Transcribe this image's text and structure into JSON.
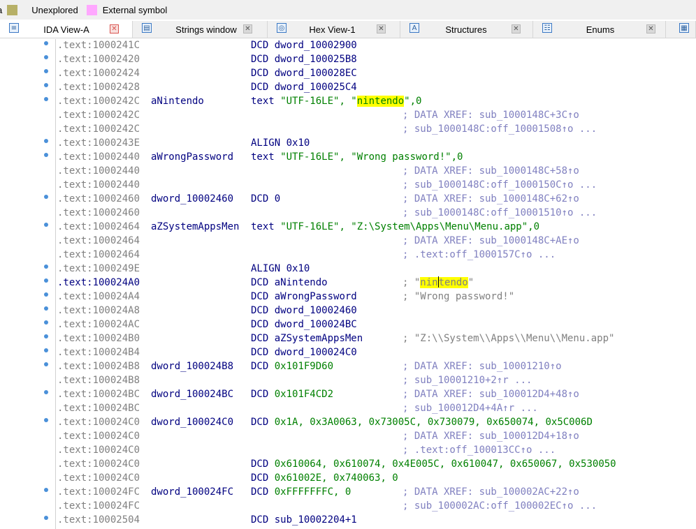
{
  "legend": [
    {
      "label": "a",
      "color": "#c0c0a0"
    },
    {
      "label": "Unexplored",
      "color": "#b7b067"
    },
    {
      "label": "External symbol",
      "color": "#ffa8ff"
    }
  ],
  "tabs": [
    {
      "label": "IDA View-A",
      "icon": "ida-view-icon",
      "active": true
    },
    {
      "label": "Strings window",
      "icon": "strings-icon",
      "active": false
    },
    {
      "label": "Hex View-1",
      "icon": "hex-icon",
      "active": false
    },
    {
      "label": "Structures",
      "icon": "structures-icon",
      "active": false
    },
    {
      "label": "Enums",
      "icon": "enums-icon",
      "active": false
    }
  ],
  "lines": [
    {
      "addr": ".text:1000241C",
      "label": "",
      "op": "DCD",
      "args": "dword_10002900",
      "comment": "",
      "dot": true
    },
    {
      "addr": ".text:10002420",
      "label": "",
      "op": "DCD",
      "args": "dword_100025B8",
      "comment": "",
      "dot": true
    },
    {
      "addr": ".text:10002424",
      "label": "",
      "op": "DCD",
      "args": "dword_100028EC",
      "comment": "",
      "dot": true
    },
    {
      "addr": ".text:10002428",
      "label": "",
      "op": "DCD",
      "args": "dword_100025C4",
      "comment": "",
      "dot": true
    },
    {
      "addr": ".text:1000242C",
      "label": "aNintendo",
      "op": "text",
      "pre": "\"UTF-16LE\", \"",
      "hl": "nintendo",
      "post": "\",0",
      "comment": "",
      "dot": true
    },
    {
      "addr": ".text:1000242C",
      "label": "",
      "op": "",
      "args": "",
      "comment": "; DATA XREF: sub_1000148C+3C↑o",
      "dot": false
    },
    {
      "addr": ".text:1000242C",
      "label": "",
      "op": "",
      "args": "",
      "comment": "; sub_1000148C:off_10001508↑o ...",
      "dot": false
    },
    {
      "addr": ".text:1000243E",
      "label": "",
      "op": "ALIGN",
      "args": "0x10",
      "comment": "",
      "dot": true
    },
    {
      "addr": ".text:10002440",
      "label": "aWrongPassword",
      "op": "text",
      "pre": "\"UTF-16LE\", \"Wrong password!\",0",
      "hl": "",
      "post": "",
      "comment": "",
      "dot": true
    },
    {
      "addr": ".text:10002440",
      "label": "",
      "op": "",
      "args": "",
      "comment": "; DATA XREF: sub_1000148C+58↑o",
      "dot": false
    },
    {
      "addr": ".text:10002440",
      "label": "",
      "op": "",
      "args": "",
      "comment": "; sub_1000148C:off_1000150C↑o ...",
      "dot": false
    },
    {
      "addr": ".text:10002460",
      "label": "dword_10002460",
      "op": "DCD",
      "args": "0",
      "comment": "; DATA XREF: sub_1000148C+62↑o",
      "dot": true
    },
    {
      "addr": ".text:10002460",
      "label": "",
      "op": "",
      "args": "",
      "comment": "; sub_1000148C:off_10001510↑o ...",
      "dot": false
    },
    {
      "addr": ".text:10002464",
      "label": "aZSystemAppsMen",
      "op": "text",
      "pre": "\"UTF-16LE\", \"Z:\\System\\Apps\\Menu\\Menu.app\",0",
      "hl": "",
      "post": "",
      "comment": "",
      "dot": true
    },
    {
      "addr": ".text:10002464",
      "label": "",
      "op": "",
      "args": "",
      "comment": "; DATA XREF: sub_1000148C+AE↑o",
      "dot": false
    },
    {
      "addr": ".text:10002464",
      "label": "",
      "op": "",
      "args": "",
      "comment": "; .text:off_1000157C↑o ...",
      "dot": false
    },
    {
      "addr": ".text:1000249E",
      "label": "",
      "op": "ALIGN",
      "args": "0x10",
      "comment": "",
      "dot": true
    },
    {
      "addr": ".text:100024A0",
      "label": "",
      "op": "DCD",
      "args": "aNintendo",
      "comment": "",
      "cmtpre": "; \"",
      "cmthl1": "nin",
      "cmthl2": "tendo",
      "cmtpost": "\"",
      "dot": true,
      "current": true
    },
    {
      "addr": ".text:100024A4",
      "label": "",
      "op": "DCD",
      "args": "aWrongPassword",
      "comment": "; \"Wrong password!\"",
      "strcomment": true,
      "dot": true
    },
    {
      "addr": ".text:100024A8",
      "label": "",
      "op": "DCD",
      "args": "dword_10002460",
      "comment": "",
      "dot": true
    },
    {
      "addr": ".text:100024AC",
      "label": "",
      "op": "DCD",
      "args": "dword_100024BC",
      "comment": "",
      "dot": true
    },
    {
      "addr": ".text:100024B0",
      "label": "",
      "op": "DCD",
      "args": "aZSystemAppsMen",
      "comment": "; \"Z:\\\\System\\\\Apps\\\\Menu\\\\Menu.app\"",
      "strcomment": true,
      "dot": true
    },
    {
      "addr": ".text:100024B4",
      "label": "",
      "op": "DCD",
      "args": "dword_100024C0",
      "comment": "",
      "dot": true
    },
    {
      "addr": ".text:100024B8",
      "label": "dword_100024B8",
      "op": "DCD",
      "args": "0x101F9D60",
      "numargs": true,
      "comment": "; DATA XREF: sub_10001210↑o",
      "dot": true
    },
    {
      "addr": ".text:100024B8",
      "label": "",
      "op": "",
      "args": "",
      "comment": "; sub_10001210+2↑r ...",
      "dot": false
    },
    {
      "addr": ".text:100024BC",
      "label": "dword_100024BC",
      "op": "DCD",
      "args": "0x101F4CD2",
      "numargs": true,
      "comment": "; DATA XREF: sub_100012D4+48↑o",
      "dot": true
    },
    {
      "addr": ".text:100024BC",
      "label": "",
      "op": "",
      "args": "",
      "comment": "; sub_100012D4+4A↑r ...",
      "dot": false
    },
    {
      "addr": ".text:100024C0",
      "label": "dword_100024C0",
      "op": "DCD",
      "args": "0x1A, 0x3A0063, 0x73005C, 0x730079, 0x650074, 0x5C006D",
      "numargs": true,
      "comment": "",
      "dot": true
    },
    {
      "addr": ".text:100024C0",
      "label": "",
      "op": "",
      "args": "",
      "comment": "; DATA XREF: sub_100012D4+18↑o",
      "dot": false
    },
    {
      "addr": ".text:100024C0",
      "label": "",
      "op": "",
      "args": "",
      "comment": "; .text:off_100013CC↑o ...",
      "dot": false
    },
    {
      "addr": ".text:100024C0",
      "label": "",
      "op": "DCD",
      "args": "0x610064, 0x610074, 0x4E005C, 0x610047, 0x650067, 0x530050",
      "numargs": true,
      "comment": "",
      "dot": false
    },
    {
      "addr": ".text:100024C0",
      "label": "",
      "op": "DCD",
      "args": "0x61002E, 0x740063, 0",
      "numargs": true,
      "comment": "",
      "dot": false
    },
    {
      "addr": ".text:100024FC",
      "label": "dword_100024FC",
      "op": "DCD",
      "args": "0xFFFFFFFC, 0",
      "numargs": true,
      "comment": "; DATA XREF: sub_100002AC+22↑o",
      "dot": true
    },
    {
      "addr": ".text:100024FC",
      "label": "",
      "op": "",
      "args": "",
      "comment": "; sub_100002AC:off_100002EC↑o ...",
      "dot": false
    },
    {
      "addr": ".text:10002504",
      "label": "",
      "op": "DCD",
      "args": "sub_10002204+1",
      "comment": "",
      "dot": true
    }
  ]
}
